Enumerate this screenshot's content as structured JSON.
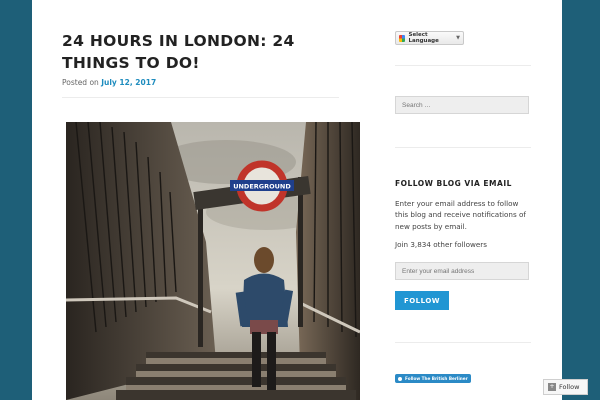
{
  "post": {
    "title": "24 HOURS IN LONDON: 24 THINGS TO DO!",
    "posted_on_label": "Posted on",
    "date": "July 12, 2017"
  },
  "sidebar": {
    "language": {
      "label": "Select Language",
      "arrow": "▼"
    },
    "search": {
      "placeholder": "Search …"
    },
    "follow_widget": {
      "title": "FOLLOW BLOG VIA EMAIL",
      "description": "Enter your email address to follow this blog and receive notifications of new posts by email.",
      "followers": "Join 3,834 other followers",
      "email_placeholder": "Enter your email address",
      "button_label": "FOLLOW"
    },
    "twitter_button": "Follow The British Berliner"
  },
  "floating": {
    "follow_label": "Follow"
  },
  "colors": {
    "frame": "#1e5f78",
    "link": "#1e8cbe",
    "button": "#2196d3"
  },
  "image": {
    "sign_text": "UNDERGROUND"
  }
}
